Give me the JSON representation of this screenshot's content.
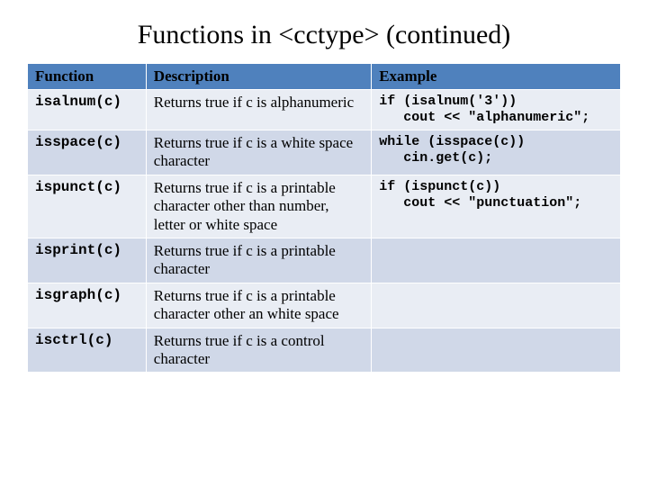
{
  "title": "Functions in <cctype> (continued)",
  "headers": {
    "function": "Function",
    "description": "Description",
    "example": "Example"
  },
  "rows": [
    {
      "function": "isalnum(c)",
      "description": "Returns true if c is alphanumeric",
      "example": "if (isalnum('3'))\n   cout << \"alphanumeric\";"
    },
    {
      "function": "isspace(c)",
      "description": "Returns true if c is a white space character",
      "example": "while (isspace(c))\n   cin.get(c);"
    },
    {
      "function": "ispunct(c)",
      "description": "Returns true if c is a printable character other than number, letter or white space",
      "example": "if (ispunct(c))\n   cout << \"punctuation\";"
    },
    {
      "function": "isprint(c)",
      "description": "Returns true if c is a printable character",
      "example": ""
    },
    {
      "function": "isgraph(c)",
      "description": "Returns true if c is a printable character other an white space",
      "example": ""
    },
    {
      "function": "isctrl(c)",
      "description": "Returns true if c is a control character",
      "example": ""
    }
  ]
}
